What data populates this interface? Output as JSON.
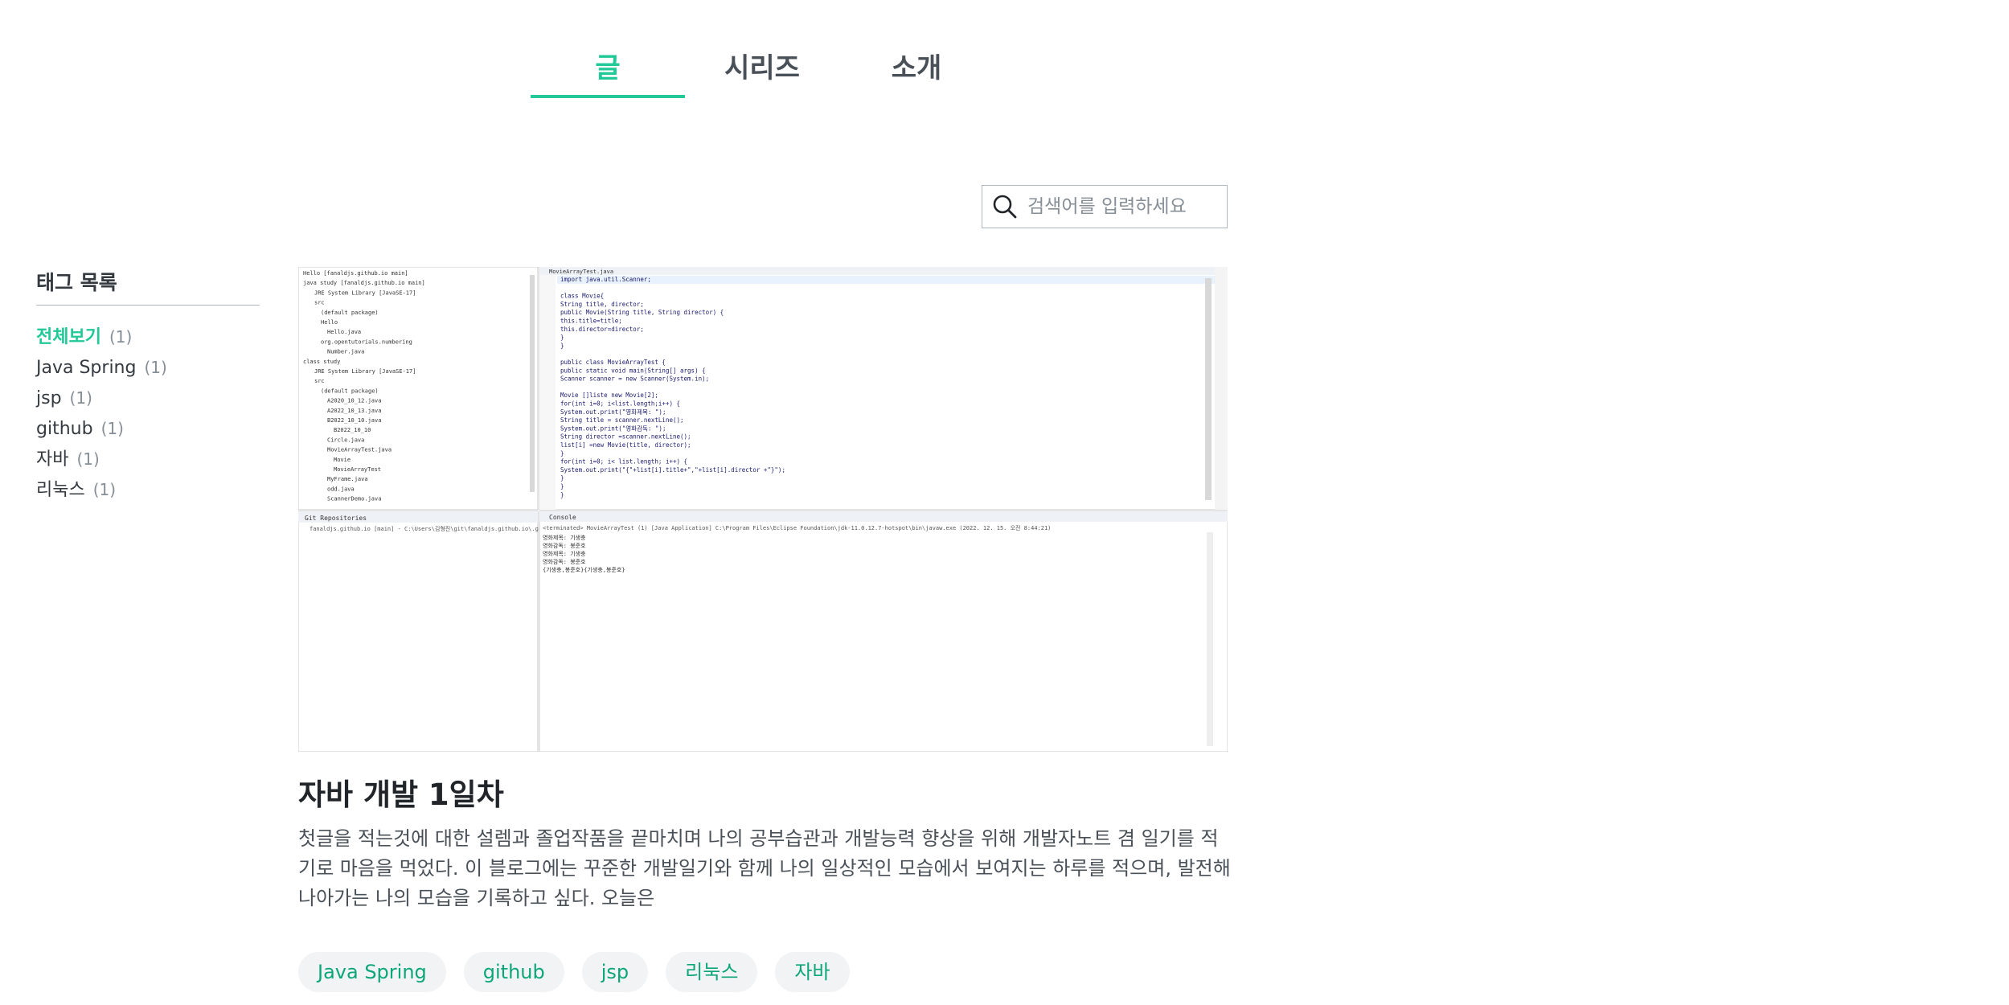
{
  "tabs": [
    {
      "label": "글",
      "active": true
    },
    {
      "label": "시리즈",
      "active": false
    },
    {
      "label": "소개",
      "active": false
    }
  ],
  "search": {
    "placeholder": "검색어를 입력하세요",
    "icon": "search-icon"
  },
  "tag_sidebar": {
    "title": "태그 목록",
    "items": [
      {
        "name": "전체보기",
        "count": "(1)",
        "active": true
      },
      {
        "name": "Java Spring",
        "count": "(1)"
      },
      {
        "name": "jsp",
        "count": "(1)"
      },
      {
        "name": "github",
        "count": "(1)"
      },
      {
        "name": "자바",
        "count": "(1)"
      },
      {
        "name": "리눅스",
        "count": "(1)"
      }
    ]
  },
  "post": {
    "title": "자바 개발 1일차",
    "description": "첫글을 적는것에 대한 설렘과 졸업작품을 끝마치며 나의 공부습관과 개발능력 향상을 위해 개발자노트 겸 일기를 적기로 마음을 먹었다. 이 블로그에는 꾸준한 개발일기와 함께 나의 일상적인 모습에서 보여지는 하루를 적으며, 발전해 나아가는 나의 모습을 기록하고 싶다. 오늘은",
    "tags": [
      "Java Spring",
      "github",
      "jsp",
      "리눅스",
      "자바"
    ],
    "thumbnail": {
      "tree_lines": [
        "Hello [fanaldjs.github.io main]",
        "java study [fanaldjs.github.io main]",
        "JRE System Library [JavaSE-17]",
        "src",
        "(default package)",
        "Hello",
        "Hello.java",
        "org.opentutorials.numbering",
        "Number.java",
        "class study",
        "JRE System Library [JavaSE-17]",
        "src",
        "(default package)",
        "A2020_10_12.java",
        "A2022_10_13.java",
        "B2022_10_10.java",
        "B2022_10_10",
        "Circle.java",
        "MovieArrayTest.java",
        "Movie",
        "MovieArrayTest",
        "MyFrame.java",
        "odd.java",
        "ScannerDemo.java"
      ],
      "editor_tab": "MovieArrayTest.java",
      "code_lines": [
        "import java.util.Scanner;",
        "",
        "class Movie{",
        "    String title, director;",
        "    public Movie(String title, String director) {",
        "        this.title=title;",
        "        this.director=director;",
        "    }",
        "}",
        "",
        "public class MovieArrayTest {",
        "    public static void main(String[] args) {",
        "        Scanner scanner = new Scanner(System.in);",
        "",
        "        Movie []liste new   Movie[2];",
        "        for(int i=0; i<list.length;i++) {",
        "            System.out.print(\"영화제목: \");",
        "            String title = scanner.nextLine();",
        "            System.out.print(\"영화감독: \");",
        "            String director =scanner.nextLine();",
        "            list[i] =new Movie(title, director);",
        "        }",
        "        for(int i=0; i< list.length; i++) {",
        "            System.out.print(\"{\"+list[i].title+\",\"+list[i].director +\"}\");",
        "        }",
        "    }",
        "}"
      ],
      "git_panel_title": "Git Repositories",
      "git_panel_line": "fanaldjs.github.io [main] - C:\\Users\\김형진\\git\\fanaldjs.github.io\\.git",
      "console_title": "Console",
      "console_header": "<terminated> MovieArrayTest (1) [Java Application] C:\\Program Files\\Eclipse Foundation\\jdk-11.0.12.7-hotspot\\bin\\javaw.exe (2022. 12. 15. 오전 8:44:21)",
      "console_lines": [
        "영화제목: 기생충",
        "영화감독: 봉준호",
        "영화제목: 기생충",
        "영화감독: 봉준호",
        "{기생충,봉준호}{기생충,봉준호}"
      ]
    }
  }
}
